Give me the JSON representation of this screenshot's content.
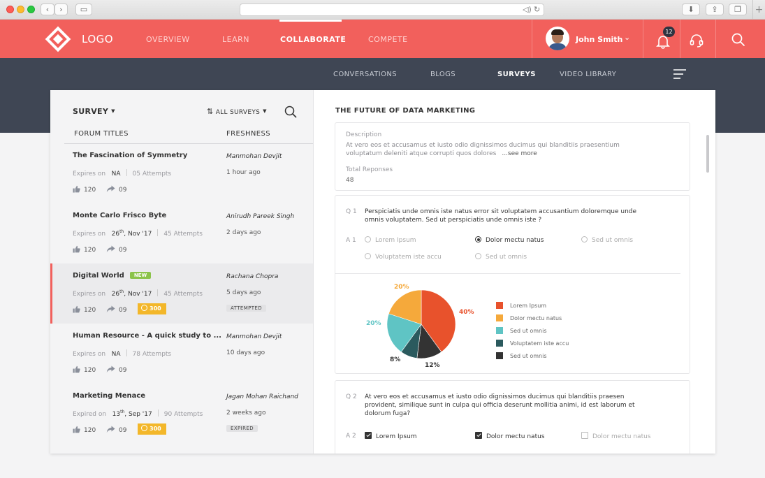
{
  "nav": {
    "logo": "LOGO",
    "items": [
      {
        "label": "OVERVIEW",
        "active": false
      },
      {
        "label": "LEARN",
        "active": false
      },
      {
        "label": "COLLABORATE",
        "active": true
      },
      {
        "label": "COMPETE",
        "active": false
      }
    ],
    "user_name": "John Smith",
    "notification_count": "12"
  },
  "subnav": {
    "items": [
      {
        "label": "CONVERSATIONS",
        "active": false
      },
      {
        "label": "BLOGS",
        "active": false
      },
      {
        "label": "SURVEYS",
        "active": true
      },
      {
        "label": "VIDEO LIBRARY",
        "active": false
      }
    ]
  },
  "left": {
    "title": "SURVEY",
    "filter": "ALL SURVEYS",
    "col_titles": "FORUM TITLES",
    "col_fresh": "FRESHNESS",
    "rows": [
      {
        "title": "The Fascination of Symmetry",
        "author": "Manmohan Devjit",
        "exp_label": "Expires on",
        "exp_value": "NA",
        "attempts": "05 Attempts",
        "ago": "1 hour ago",
        "likes": "120",
        "shares": "09"
      },
      {
        "title": "Monte Carlo Frisco Byte",
        "author": "Anirudh Pareek Singh",
        "exp_label": "Expires on",
        "exp_day": "26",
        "exp_sup": "th",
        "exp_rest": ", Nov '17",
        "attempts": "45 Attempts",
        "ago": "2 days ago",
        "likes": "120",
        "shares": "09"
      },
      {
        "title": "Digital World",
        "tag": "NEW",
        "author": "Rachana Chopra",
        "exp_label": "Expires on",
        "exp_day": "26",
        "exp_sup": "th",
        "exp_rest": ", Nov '17",
        "attempts": "45 Attempts",
        "ago": "5 days ago",
        "likes": "120",
        "shares": "09",
        "points": "300",
        "status": "ATTEMPTED"
      },
      {
        "title": "Human Resource -  A quick study to ...",
        "author": "Manmohan Devjit",
        "exp_label": "Expires on",
        "exp_value": "NA",
        "attempts": "78 Attempts",
        "ago": "10 days ago",
        "likes": "120",
        "shares": "09"
      },
      {
        "title": "Marketing Menace",
        "author": "Jagan Mohan Raichand",
        "exp_label": "Expired on",
        "exp_day": "13",
        "exp_sup": "th",
        "exp_rest": ", Sep '17",
        "attempts": "90 Attempts",
        "ago": "2 weeks ago",
        "likes": "120",
        "shares": "09",
        "points": "300",
        "status": "EXPIRED"
      }
    ]
  },
  "right": {
    "title": "THE FUTURE OF DATA MARKETING",
    "description_label": "Description",
    "description": "At vero eos et accusamus et iusto odio dignissimos ducimus qui blanditiis praesentium voluptatum deleniti atque corrupti quos dolores",
    "see_more": "...see more",
    "total_label": "Total Reponses",
    "total_value": "48",
    "q1": {
      "num": "Q 1",
      "text": "Perspiciatis unde omnis iste natus error sit voluptatem accusantium doloremque unde omnis voluptatem. Sed ut perspiciatis unde omnis iste ?",
      "ans_num": "A 1",
      "options": [
        "Lorem Ipsum",
        "Dolor mectu natus",
        "Sed ut omnis",
        "Voluptatem iste accu",
        "Sed ut omnis"
      ],
      "selected_index": 1
    },
    "q2": {
      "num": "Q 2",
      "text": "At vero eos et accusamus et iusto odio dignissimos ducimus qui blanditiis praesen provident, similique sunt in culpa qui officia deserunt mollitia animi, id est laborum et dolorum fuga?",
      "ans_num": "A 2",
      "options": [
        "Lorem Ipsum",
        "Dolor mectu natus",
        "Dolor mectu natus"
      ],
      "checked": [
        true,
        true,
        false
      ]
    }
  },
  "chart_data": {
    "type": "pie",
    "categories": [
      "Lorem Ipsum",
      "Dolor mectu natus",
      "Sed ut omnis",
      "Voluptatem iste accu",
      "Sed ut omnis"
    ],
    "values": [
      40,
      20,
      20,
      8,
      12
    ],
    "labels": [
      "40%",
      "20%",
      "20%",
      "8%",
      "12%"
    ],
    "colors": [
      "#e8522c",
      "#f5a93b",
      "#5fc4c4",
      "#2b5a5e",
      "#333333"
    ],
    "legend": "right"
  }
}
